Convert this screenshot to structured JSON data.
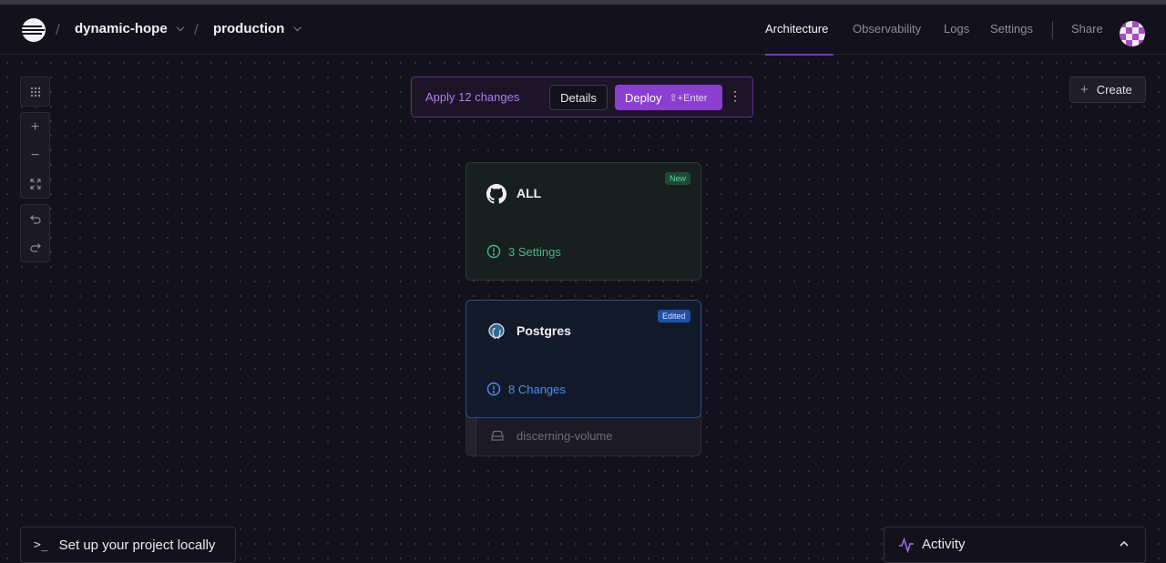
{
  "header": {
    "project": "dynamic-hope",
    "environment": "production",
    "nav": {
      "architecture": "Architecture",
      "observability": "Observability",
      "logs": "Logs",
      "settings": "Settings",
      "share": "Share"
    },
    "separator": "/"
  },
  "toolbar": {
    "apply_text": "Apply 12 changes",
    "details_label": "Details",
    "deploy_label": "Deploy",
    "deploy_shortcut": "⇧+Enter"
  },
  "create": {
    "label": "Create"
  },
  "services": [
    {
      "name": "ALL",
      "badge": "New",
      "status": "3 Settings",
      "icon": "github-icon"
    },
    {
      "name": "Postgres",
      "badge": "Edited",
      "status": "8 Changes",
      "icon": "postgres-icon",
      "volume": "discerning-volume"
    }
  ],
  "bottom": {
    "local_label": "Set up your project locally",
    "activity_label": "Activity"
  },
  "colors": {
    "accent": "#8a3fd1",
    "new_badge": "#1d4a35",
    "edited_badge": "#1f4fa7",
    "background": "#13111c"
  }
}
